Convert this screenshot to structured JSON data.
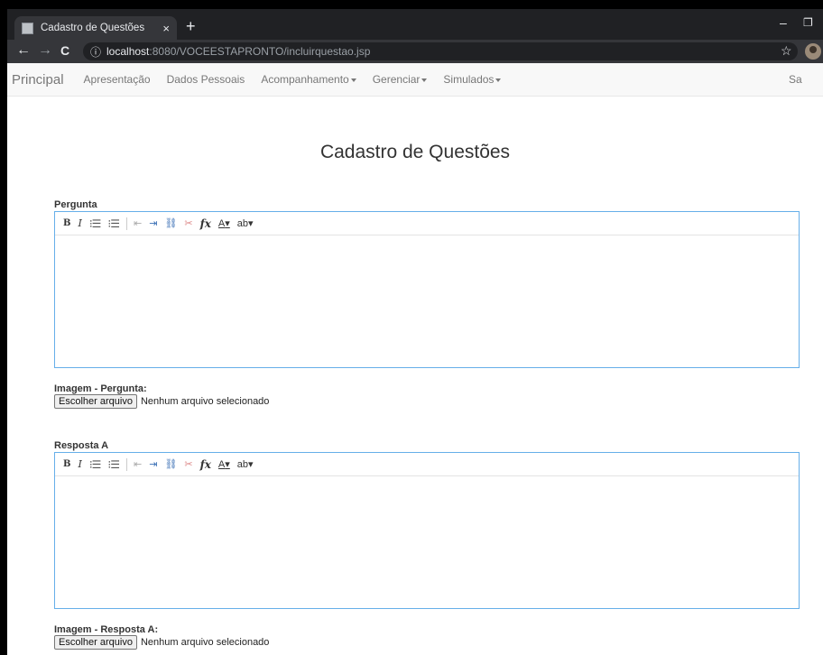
{
  "browser": {
    "tab_title": "Cadastro de Questões",
    "tab_close": "×",
    "new_tab": "+",
    "url_host": "localhost",
    "url_rest": ":8080/VOCEESTAPRONTO/incluirquestao.jsp",
    "info_icon": "ⓘ",
    "back": "←",
    "forward": "→",
    "reload": "C",
    "star": "☆",
    "minimize": "–",
    "restore": "❐"
  },
  "navbar": {
    "brand": "Principal",
    "items": [
      "Apresentação",
      "Dados Pessoais",
      "Acompanhamento",
      "Gerenciar",
      "Simulados"
    ],
    "right": "Sa"
  },
  "page": {
    "title": "Cadastro de Questões"
  },
  "editor_toolbar": {
    "bold": "B",
    "italic": "I",
    "ordered_list": "⁝☰",
    "unordered_list": "⁝☰",
    "outdent": "⇤",
    "indent": "⇥",
    "link": "⛓",
    "unlink": "✂",
    "formula": "fx",
    "text_color": "A",
    "highlight": "ab",
    "dropdown": "▾"
  },
  "sections": [
    {
      "label": "Pergunta",
      "image_label": "Imagem - Pergunta:",
      "file_button": "Escolher arquivo",
      "file_status": "Nenhum arquivo selecionado"
    },
    {
      "label": "Resposta A",
      "image_label": "Imagem - Resposta A:",
      "file_button": "Escolher arquivo",
      "file_status": "Nenhum arquivo selecionado"
    }
  ]
}
